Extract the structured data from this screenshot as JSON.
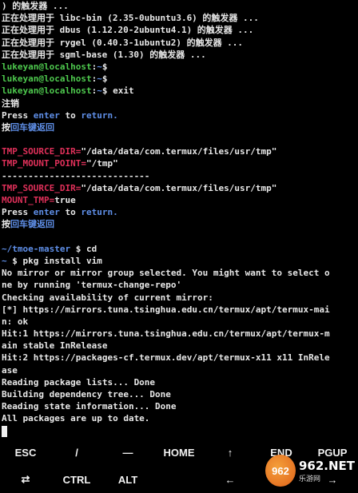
{
  "terminal": {
    "lines": [
      [
        {
          "t": ") 的触发器 ...",
          "c": "white"
        }
      ],
      [
        {
          "t": "正在处理用于 libc-bin (2.35-0ubuntu3.6) 的触发器 ...",
          "c": "white"
        }
      ],
      [
        {
          "t": "正在处理用于 dbus (1.12.20-2ubuntu4.1) 的触发器 ...",
          "c": "white"
        }
      ],
      [
        {
          "t": "正在处理用于 rygel (0.40.3-1ubuntu2) 的触发器 ...",
          "c": "white"
        }
      ],
      [
        {
          "t": "正在处理用于 sgml-base (1.30) 的触发器 ...",
          "c": "white"
        }
      ],
      [
        {
          "t": "lukeyan@localhost",
          "c": "green"
        },
        {
          "t": ":",
          "c": "white"
        },
        {
          "t": "~",
          "c": "blue"
        },
        {
          "t": "$",
          "c": "white"
        }
      ],
      [
        {
          "t": "lukeyan@localhost",
          "c": "green"
        },
        {
          "t": ":",
          "c": "white"
        },
        {
          "t": "~",
          "c": "blue"
        },
        {
          "t": "$",
          "c": "white"
        }
      ],
      [
        {
          "t": "lukeyan@localhost",
          "c": "green"
        },
        {
          "t": ":",
          "c": "white"
        },
        {
          "t": "~",
          "c": "blue"
        },
        {
          "t": "$ exit",
          "c": "white"
        }
      ],
      [
        {
          "t": "注销",
          "c": "white"
        }
      ],
      [
        {
          "t": "Press ",
          "c": "white"
        },
        {
          "t": "enter",
          "c": "blue"
        },
        {
          "t": " to ",
          "c": "white"
        },
        {
          "t": "return.",
          "c": "blue"
        }
      ],
      [
        {
          "t": "按",
          "c": "white"
        },
        {
          "t": "回车键返回",
          "c": "blue"
        }
      ],
      [
        {
          "t": "",
          "c": "white"
        }
      ],
      [
        {
          "t": "TMP_SOURCE_DIR=",
          "c": "red"
        },
        {
          "t": "\"/data/data/com.termux/files/usr/tmp\"",
          "c": "white"
        }
      ],
      [
        {
          "t": "TMP_MOUNT_POINT=",
          "c": "red"
        },
        {
          "t": "\"/tmp\"",
          "c": "white"
        }
      ],
      [
        {
          "t": "----------------------------",
          "c": "white"
        }
      ],
      [
        {
          "t": "TMP_SOURCE_DIR=",
          "c": "red"
        },
        {
          "t": "\"/data/data/com.termux/files/usr/tmp\"",
          "c": "white"
        }
      ],
      [
        {
          "t": "MOUNT_TMP=",
          "c": "red"
        },
        {
          "t": "true",
          "c": "white"
        }
      ],
      [
        {
          "t": "Press ",
          "c": "white"
        },
        {
          "t": "enter",
          "c": "blue"
        },
        {
          "t": " to ",
          "c": "white"
        },
        {
          "t": "return.",
          "c": "blue"
        }
      ],
      [
        {
          "t": "按",
          "c": "white"
        },
        {
          "t": "回车键返回",
          "c": "blue"
        }
      ],
      [
        {
          "t": "",
          "c": "white"
        }
      ],
      [
        {
          "t": "~/tmoe-master",
          "c": "blue"
        },
        {
          "t": " $ cd",
          "c": "white"
        }
      ],
      [
        {
          "t": "~",
          "c": "blue"
        },
        {
          "t": " $ pkg install vim",
          "c": "white"
        }
      ],
      [
        {
          "t": "No mirror or mirror group selected. You might want to select o",
          "c": "white"
        }
      ],
      [
        {
          "t": "ne by running 'termux-change-repo'",
          "c": "white"
        }
      ],
      [
        {
          "t": "Checking availability of current mirror:",
          "c": "white"
        }
      ],
      [
        {
          "t": "[*] https://mirrors.tuna.tsinghua.edu.cn/termux/apt/termux-mai",
          "c": "white"
        }
      ],
      [
        {
          "t": "n: ok",
          "c": "white"
        }
      ],
      [
        {
          "t": "Hit:1 https://mirrors.tuna.tsinghua.edu.cn/termux/apt/termux-m",
          "c": "white"
        }
      ],
      [
        {
          "t": "ain stable InRelease",
          "c": "white"
        }
      ],
      [
        {
          "t": "Hit:2 https://packages-cf.termux.dev/apt/termux-x11 x11 InRele",
          "c": "white"
        }
      ],
      [
        {
          "t": "ase",
          "c": "white"
        }
      ],
      [
        {
          "t": "Reading package lists... Done",
          "c": "white"
        }
      ],
      [
        {
          "t": "Building dependency tree... Done",
          "c": "white"
        }
      ],
      [
        {
          "t": "Reading state information... Done",
          "c": "white"
        }
      ],
      [
        {
          "t": "All packages are up to date.",
          "c": "white"
        }
      ]
    ]
  },
  "extra_keys": {
    "row1": [
      "ESC",
      "/",
      "—",
      "HOME",
      "↑",
      "END",
      "PGUP"
    ],
    "row2": [
      "⇄",
      "CTRL",
      "ALT",
      "",
      "←",
      "↓",
      "→"
    ]
  },
  "watermark": {
    "logo": "962",
    "text": "962.NET",
    "subtext": "乐游网"
  }
}
